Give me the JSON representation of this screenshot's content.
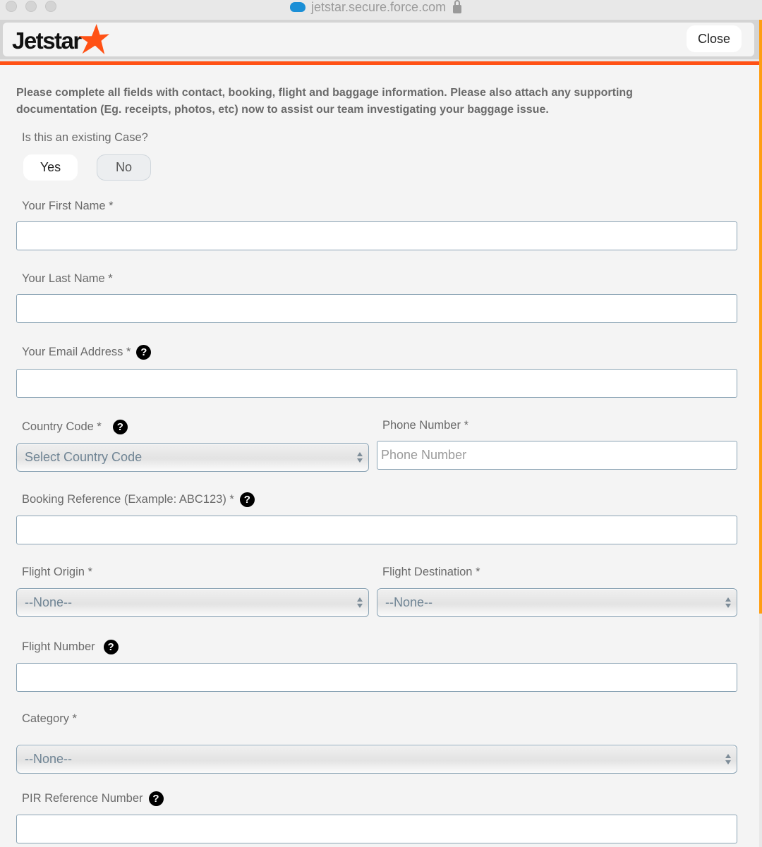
{
  "browser": {
    "url": "jetstar.secure.force.com",
    "site_icon": "salesforce-cloud-icon",
    "lock_icon": "lock-icon"
  },
  "header": {
    "logo_text": "Jetstar",
    "close_label": "Close"
  },
  "colors": {
    "brand_orange": "#ff5115",
    "accent_orange": "#ff9e12",
    "input_border": "#8aa3b4"
  },
  "form": {
    "intro": "Please complete all fields with contact, booking, flight and baggage information. Please also attach any supporting documentation (Eg. receipts, photos, etc) now to assist our team investigating your baggage issue.",
    "existing_case": {
      "label": "Is this an existing Case?",
      "yes_label": "Yes",
      "no_label": "No",
      "selected": "Yes"
    },
    "first_name": {
      "label": "Your First Name *",
      "value": ""
    },
    "last_name": {
      "label": "Your Last Name *",
      "value": ""
    },
    "email": {
      "label": "Your Email Address *",
      "value": "",
      "help": "?"
    },
    "country_code": {
      "label": "Country Code *",
      "selected": "Select Country Code",
      "help": "?"
    },
    "phone": {
      "label": "Phone Number *",
      "value": "",
      "placeholder": "Phone Number"
    },
    "booking_ref": {
      "label": "Booking Reference (Example: ABC123) *",
      "value": "",
      "help": "?"
    },
    "flight_origin": {
      "label": "Flight Origin *",
      "selected": "--None--"
    },
    "flight_destination": {
      "label": "Flight Destination *",
      "selected": "--None--"
    },
    "flight_number": {
      "label": "Flight Number",
      "value": "",
      "help": "?"
    },
    "category": {
      "label": "Category *",
      "selected": "--None--"
    },
    "pir_ref": {
      "label": "PIR Reference Number",
      "value": "",
      "help": "?"
    }
  }
}
